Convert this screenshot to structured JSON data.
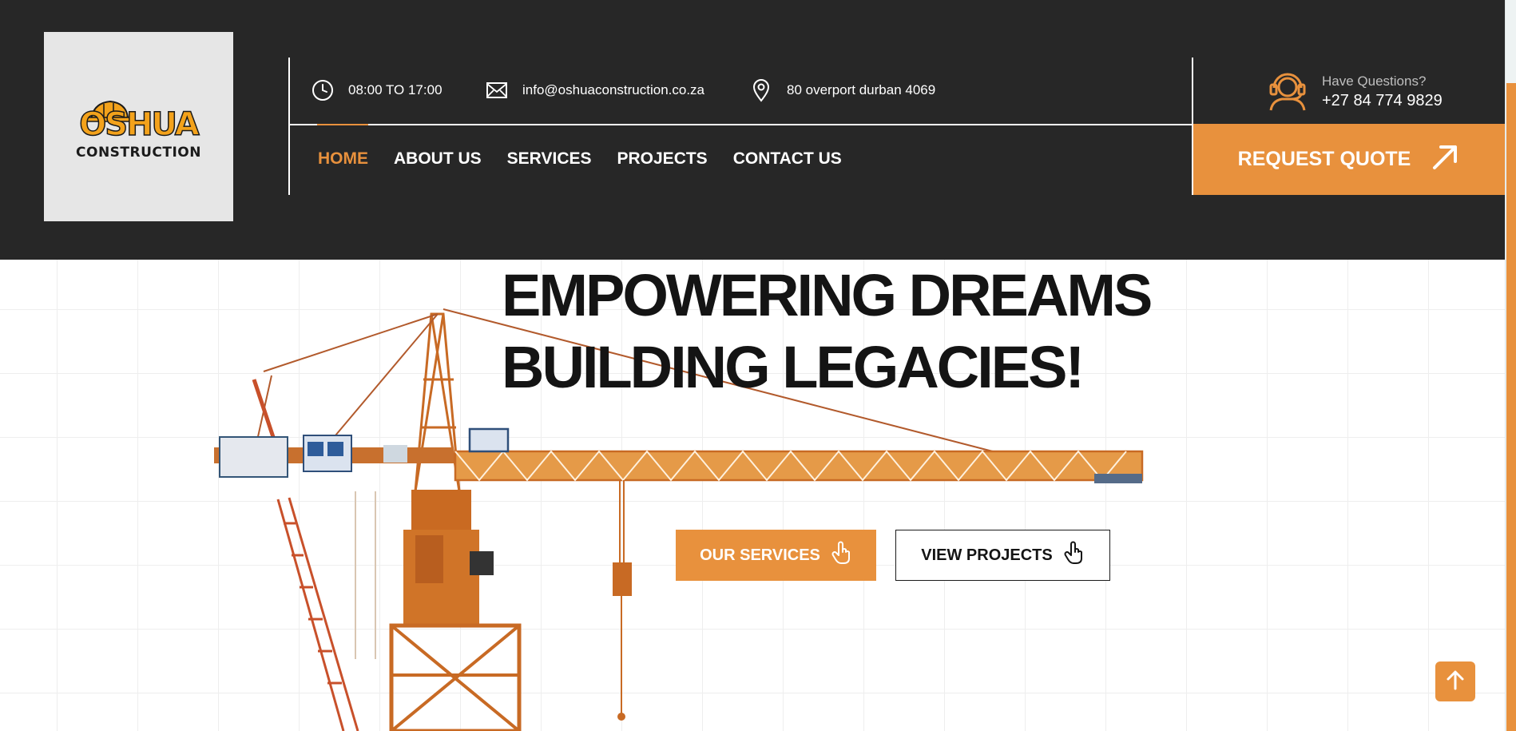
{
  "logo": {
    "word": "OSHUA",
    "sub": "CONSTRUCTION"
  },
  "topbar": {
    "hours": "08:00 TO 17:00",
    "email": "info@oshuaconstruction.co.za",
    "address": "80 overport durban 4069"
  },
  "nav": {
    "items": [
      {
        "label": "HOME",
        "active": true
      },
      {
        "label": "ABOUT US"
      },
      {
        "label": "SERVICES"
      },
      {
        "label": "PROJECTS"
      },
      {
        "label": "CONTACT US"
      }
    ]
  },
  "contact": {
    "label": "Have Questions?",
    "phone": "+27 84 774 9829"
  },
  "quote_button": "REQUEST QUOTE",
  "hero": {
    "line1": "EMPOWERING DREAMS",
    "line2": "BUILDING LEGACIES!",
    "primary_button": "OUR SERVICES",
    "secondary_button": "VIEW PROJECTS"
  },
  "colors": {
    "accent": "#e8913d",
    "header_bg": "#272727",
    "text_dark": "#141414"
  },
  "icons": [
    "clock-icon",
    "mail-icon",
    "location-pin-icon",
    "headset-icon",
    "arrow-up-right-icon",
    "hand-pointer-icon",
    "arrow-up-icon"
  ]
}
